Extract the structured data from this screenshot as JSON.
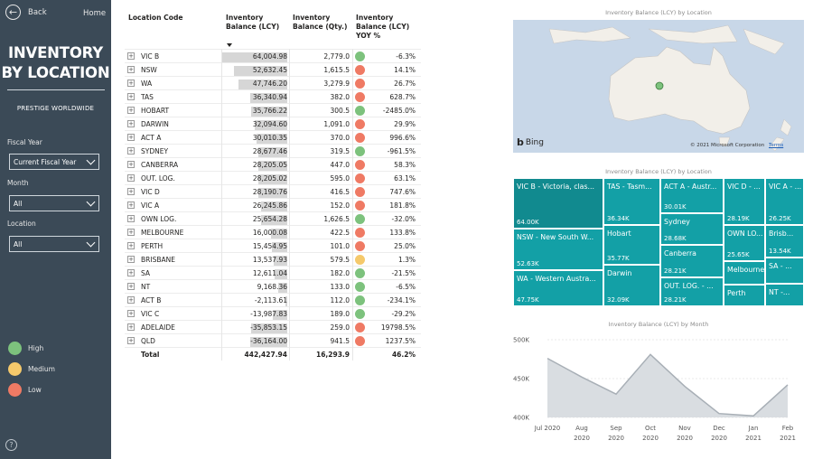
{
  "sidebar": {
    "back_label": "Back",
    "home_label": "Home",
    "title_line1": "INVENTORY",
    "title_line2": "BY LOCATION",
    "subtitle": "PRESTIGE WORLDWIDE",
    "filters": [
      {
        "label": "Fiscal Year",
        "value": "Current Fiscal Year"
      },
      {
        "label": "Month",
        "value": "All"
      },
      {
        "label": "Location",
        "value": "All"
      }
    ],
    "legend": [
      {
        "label": "High",
        "color": "#7dc27d"
      },
      {
        "label": "Medium",
        "color": "#f5c96b"
      },
      {
        "label": "Low",
        "color": "#ef7a64"
      }
    ],
    "help_icon": "?"
  },
  "table": {
    "headers": {
      "location": "Location Code",
      "balance_lcy_1": "Inventory",
      "balance_lcy_2": "Balance (LCY)",
      "balance_qty_1": "Inventory",
      "balance_qty_2": "Balance (Qty.)",
      "yoy_1": "Inventory",
      "yoy_2": "Balance (LCY)",
      "yoy_3": "YOY %"
    },
    "rows": [
      {
        "code": "VIC B",
        "lcy": "64,004.98",
        "lcy_value": 64004.98,
        "qty": "2,779.0",
        "status": "#7dc27d",
        "yoy": "-6.3%"
      },
      {
        "code": "NSW",
        "lcy": "52,632.45",
        "lcy_value": 52632.45,
        "qty": "1,615.5",
        "status": "#ef7a64",
        "yoy": "14.1%"
      },
      {
        "code": "WA",
        "lcy": "47,746.20",
        "lcy_value": 47746.2,
        "qty": "3,279.9",
        "status": "#ef7a64",
        "yoy": "26.7%"
      },
      {
        "code": "TAS",
        "lcy": "36,340.94",
        "lcy_value": 36340.94,
        "qty": "382.0",
        "status": "#ef7a64",
        "yoy": "628.7%"
      },
      {
        "code": "HOBART",
        "lcy": "35,766.22",
        "lcy_value": 35766.22,
        "qty": "300.5",
        "status": "#7dc27d",
        "yoy": "-2485.0%"
      },
      {
        "code": "DARWIN",
        "lcy": "32,094.60",
        "lcy_value": 32094.6,
        "qty": "1,091.0",
        "status": "#ef7a64",
        "yoy": "29.9%"
      },
      {
        "code": "ACT A",
        "lcy": "30,010.35",
        "lcy_value": 30010.35,
        "qty": "370.0",
        "status": "#ef7a64",
        "yoy": "996.6%"
      },
      {
        "code": "SYDNEY",
        "lcy": "28,677.46",
        "lcy_value": 28677.46,
        "qty": "319.5",
        "status": "#7dc27d",
        "yoy": "-961.5%"
      },
      {
        "code": "CANBERRA",
        "lcy": "28,205.05",
        "lcy_value": 28205.05,
        "qty": "447.0",
        "status": "#ef7a64",
        "yoy": "58.3%"
      },
      {
        "code": "OUT. LOG.",
        "lcy": "28,205.02",
        "lcy_value": 28205.02,
        "qty": "595.0",
        "status": "#ef7a64",
        "yoy": "63.1%"
      },
      {
        "code": "VIC D",
        "lcy": "28,190.76",
        "lcy_value": 28190.76,
        "qty": "416.5",
        "status": "#ef7a64",
        "yoy": "747.6%"
      },
      {
        "code": "VIC A",
        "lcy": "26,245.86",
        "lcy_value": 26245.86,
        "qty": "152.0",
        "status": "#ef7a64",
        "yoy": "181.8%"
      },
      {
        "code": "OWN LOG.",
        "lcy": "25,654.28",
        "lcy_value": 25654.28,
        "qty": "1,626.5",
        "status": "#7dc27d",
        "yoy": "-32.0%"
      },
      {
        "code": "MELBOURNE",
        "lcy": "16,000.08",
        "lcy_value": 16000.08,
        "qty": "422.5",
        "status": "#ef7a64",
        "yoy": "133.8%"
      },
      {
        "code": "PERTH",
        "lcy": "15,454.95",
        "lcy_value": 15454.95,
        "qty": "101.0",
        "status": "#ef7a64",
        "yoy": "25.0%"
      },
      {
        "code": "BRISBANE",
        "lcy": "13,537.93",
        "lcy_value": 13537.93,
        "qty": "579.5",
        "status": "#f5c96b",
        "yoy": "1.3%"
      },
      {
        "code": "SA",
        "lcy": "12,611.04",
        "lcy_value": 12611.04,
        "qty": "182.0",
        "status": "#7dc27d",
        "yoy": "-21.5%"
      },
      {
        "code": "NT",
        "lcy": "9,168.36",
        "lcy_value": 9168.36,
        "qty": "133.0",
        "status": "#7dc27d",
        "yoy": "-6.5%"
      },
      {
        "code": "ACT B",
        "lcy": "-2,113.61",
        "lcy_value": -2113.61,
        "qty": "112.0",
        "status": "#7dc27d",
        "yoy": "-234.1%"
      },
      {
        "code": "VIC C",
        "lcy": "-13,987.83",
        "lcy_value": -13987.83,
        "qty": "189.0",
        "status": "#7dc27d",
        "yoy": "-29.2%"
      },
      {
        "code": "ADELAIDE",
        "lcy": "-35,853.15",
        "lcy_value": -35853.15,
        "qty": "259.0",
        "status": "#ef7a64",
        "yoy": "19798.5%"
      },
      {
        "code": "QLD",
        "lcy": "-36,164.00",
        "lcy_value": -36164.0,
        "qty": "941.5",
        "status": "#ef7a64",
        "yoy": "1237.5%"
      }
    ],
    "total": {
      "label": "Total",
      "lcy": "442,427.94",
      "qty": "16,293.9",
      "yoy": "46.2%"
    }
  },
  "map": {
    "title": "Inventory Balance (LCY) by Location",
    "logo_text": "Bing",
    "copyright": "© 2021 Microsoft Corporation",
    "terms": "Terms"
  },
  "treemap": {
    "title": "Inventory Balance (LCY) by Location",
    "tiles": [
      {
        "label": "VIC B - Victoria, clas...",
        "value": "64.00K",
        "color": "#118a8f"
      },
      {
        "label": "NSW - New South W...",
        "value": "52.63K",
        "color": "#13a0a6"
      },
      {
        "label": "WA - Western Austra...",
        "value": "47.75K",
        "color": "#13a0a6"
      },
      {
        "label": "TAS - Tasm...",
        "value": "36.34K",
        "color": "#13a0a6"
      },
      {
        "label": "Hobart",
        "value": "35.77K",
        "color": "#13a0a6"
      },
      {
        "label": "Darwin",
        "value": "32.09K",
        "color": "#13a0a6"
      },
      {
        "label": "ACT A - Austr...",
        "value": "30.01K",
        "color": "#13a0a6"
      },
      {
        "label": "Sydney",
        "value": "28.68K",
        "color": "#13a0a6"
      },
      {
        "label": "Canberra",
        "value": "28.21K",
        "color": "#13a0a6"
      },
      {
        "label": "OUT. LOG. - ...",
        "value": "28.21K",
        "color": "#13a0a6"
      },
      {
        "label": "VIC D - ...",
        "value": "28.19K",
        "color": "#13a0a6"
      },
      {
        "label": "VIC A - ...",
        "value": "26.25K",
        "color": "#13a0a6"
      },
      {
        "label": "OWN LO...",
        "value": "25.65K",
        "color": "#13a0a6"
      },
      {
        "label": "Melbourne",
        "value": "",
        "color": "#13a0a6"
      },
      {
        "label": "Perth",
        "value": "",
        "color": "#13a0a6"
      },
      {
        "label": "Brisb...",
        "value": "13.54K",
        "color": "#13a0a6"
      },
      {
        "label": "SA - ...",
        "value": "",
        "color": "#13a0a6"
      },
      {
        "label": "NT -...",
        "value": "",
        "color": "#13a0a6"
      }
    ]
  },
  "chart_data": {
    "type": "area",
    "title": "Inventory Balance (LCY) by Month",
    "categories": [
      "Jul 2020",
      "Aug 2020",
      "Sep 2020",
      "Oct 2020",
      "Nov 2020",
      "Dec 2020",
      "Jan 2021",
      "Feb 2021"
    ],
    "values": [
      476,
      452,
      430,
      481,
      440,
      405,
      402,
      442
    ],
    "yunit": "K",
    "ytick_labels": [
      "500K",
      "450K",
      "400K"
    ],
    "ylim": [
      400,
      500
    ],
    "fill_color": "#d9dde1",
    "line_color": "#a8afb6"
  }
}
